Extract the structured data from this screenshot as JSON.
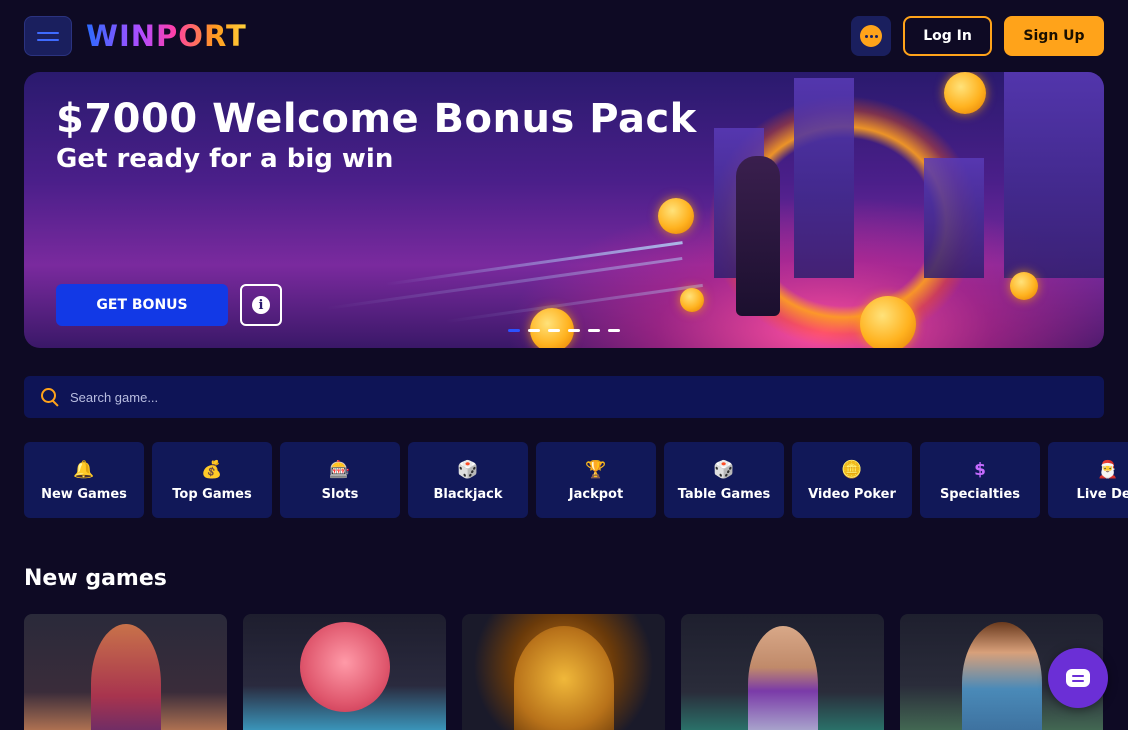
{
  "header": {
    "logo_text": "WINPORT",
    "login_label": "Log In",
    "signup_label": "Sign Up"
  },
  "banner": {
    "title": "$7000 Welcome Bonus Pack",
    "subtitle": "Get ready for a big win",
    "cta_label": "GET BONUS",
    "info_glyph": "i",
    "slides_total": 6,
    "active_slide": 1
  },
  "search": {
    "placeholder": "Search game..."
  },
  "categories": [
    {
      "label": "New Games",
      "icon": "bell-icon",
      "glyph": "🔔"
    },
    {
      "label": "Top Games",
      "icon": "money-bag-icon",
      "glyph": "💰"
    },
    {
      "label": "Slots",
      "icon": "slot-machine-icon",
      "glyph": "🎰"
    },
    {
      "label": "Blackjack",
      "icon": "dice-icon",
      "glyph": "🎲"
    },
    {
      "label": "Jackpot",
      "icon": "mega-win-icon",
      "glyph": "🏆"
    },
    {
      "label": "Table Games",
      "icon": "die-icon",
      "glyph": "🎲"
    },
    {
      "label": "Video Poker",
      "icon": "chips-stack-icon",
      "glyph": "🪙"
    },
    {
      "label": "Specialties",
      "icon": "dollar-icon",
      "glyph": "$"
    },
    {
      "label": "Live Dea",
      "icon": "live-dealer-icon",
      "glyph": "🎅"
    }
  ],
  "sections": {
    "new_games_title": "New games"
  },
  "colors": {
    "background": "#0e0a24",
    "accent": "#ffa31a",
    "primary_blue": "#1239e6",
    "card_bg": "#111858"
  }
}
